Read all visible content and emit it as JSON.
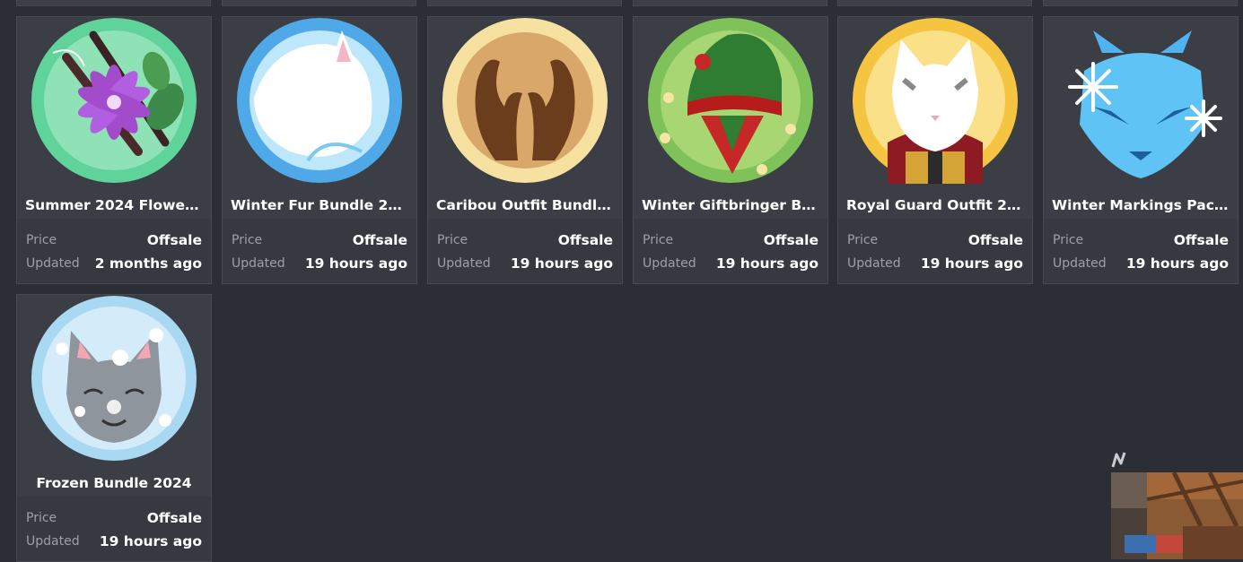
{
  "cards": [
    {
      "name": "Summer 2024 Flower B...",
      "price_label": "Price",
      "price": "Offsale",
      "updated_label": "Updated",
      "updated": "2 months ago"
    },
    {
      "name": "Winter Fur Bundle 2024",
      "price_label": "Price",
      "price": "Offsale",
      "updated_label": "Updated",
      "updated": "19 hours ago"
    },
    {
      "name": "Caribou Outfit Bundle ...",
      "price_label": "Price",
      "price": "Offsale",
      "updated_label": "Updated",
      "updated": "19 hours ago"
    },
    {
      "name": "Winter Giftbringer Bun...",
      "price_label": "Price",
      "price": "Offsale",
      "updated_label": "Updated",
      "updated": "19 hours ago"
    },
    {
      "name": "Royal Guard Outfit 2024",
      "price_label": "Price",
      "price": "Offsale",
      "updated_label": "Updated",
      "updated": "19 hours ago"
    },
    {
      "name": "Winter Markings Pack ...",
      "price_label": "Price",
      "price": "Offsale",
      "updated_label": "Updated",
      "updated": "19 hours ago"
    },
    {
      "name": "Frozen Bundle 2024",
      "price_label": "Price",
      "price": "Offsale",
      "updated_label": "Updated",
      "updated": "19 hours ago"
    }
  ],
  "icons": {
    "c0": "flower-bundle-icon",
    "c1": "winter-fur-icon",
    "c2": "caribou-antlers-icon",
    "c3": "giftbringer-hat-icon",
    "c4": "royal-guard-cat-icon",
    "c5": "winter-markings-icon",
    "c6": "frozen-cat-icon"
  },
  "colors": {
    "background": "#2b2f35",
    "card": "#3b3f45",
    "meta": "#363a40",
    "label": "#9da0a5"
  }
}
